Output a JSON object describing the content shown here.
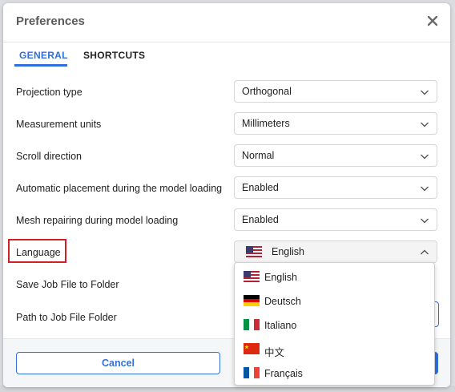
{
  "dialog": {
    "title": "Preferences"
  },
  "tabs": [
    {
      "label": "GENERAL",
      "active": true
    },
    {
      "label": "SHORTCUTS",
      "active": false
    }
  ],
  "settings": [
    {
      "label": "Projection type",
      "value": "Orthogonal"
    },
    {
      "label": "Measurement units",
      "value": "Millimeters"
    },
    {
      "label": "Scroll direction",
      "value": "Normal"
    },
    {
      "label": "Automatic placement during the model loading",
      "value": "Enabled"
    },
    {
      "label": "Mesh repairing during model loading",
      "value": "Enabled"
    },
    {
      "label": "Language",
      "value": "English"
    },
    {
      "label": "Save Job File to Folder"
    },
    {
      "label": "Path to Job File Folder"
    }
  ],
  "language_options": [
    {
      "label": "English",
      "flag": "us-flag-icon"
    },
    {
      "label": "Deutsch",
      "flag": "de-flag-icon"
    },
    {
      "label": "Italiano",
      "flag": "it-flag-icon"
    },
    {
      "label": "中文",
      "flag": "cn-flag-icon"
    },
    {
      "label": "Français",
      "flag": "fr-flag-icon"
    }
  ],
  "footer": {
    "cancel_label": "Cancel"
  },
  "colors": {
    "accent": "#2f6fde",
    "highlight": "#d32027"
  }
}
